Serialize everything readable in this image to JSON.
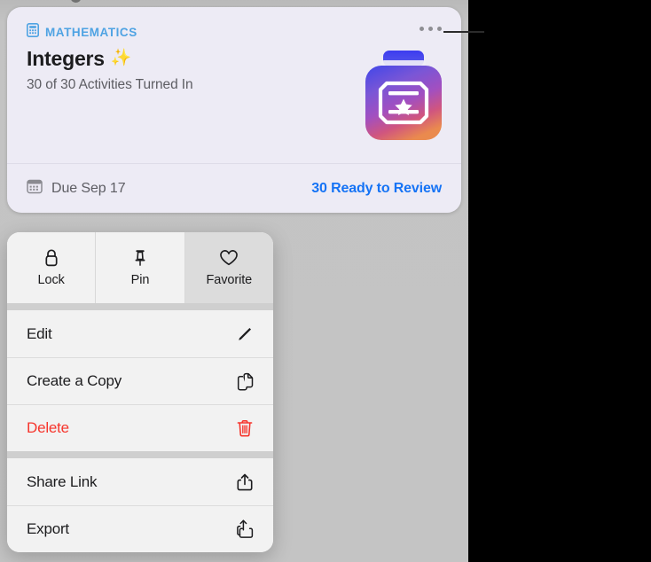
{
  "card": {
    "subject": "MATHEMATICS",
    "subject_icon": "calculator-icon",
    "title": "Integers",
    "title_emoji": "✨",
    "progress_text": "30 of 30 Activities Turned In",
    "more_button_label": "•••",
    "app_icon_name": "assignment-app-icon",
    "footer": {
      "due_icon": "calendar-icon",
      "due_text": "Due Sep 17",
      "review_link": "30 Ready to Review"
    },
    "colors": {
      "card_background": "#edebf5",
      "subject_blue": "#4fa3e3",
      "link_blue": "#1573f5",
      "secondary_text": "#5d5d63"
    }
  },
  "context_menu": {
    "quick_actions": [
      {
        "label": "Lock",
        "icon": "lock-icon"
      },
      {
        "label": "Pin",
        "icon": "pin-icon"
      },
      {
        "label": "Favorite",
        "icon": "heart-icon"
      }
    ],
    "groups": [
      {
        "items": [
          {
            "label": "Edit",
            "icon": "pencil-icon",
            "destructive": false
          },
          {
            "label": "Create a Copy",
            "icon": "duplicate-icon",
            "destructive": false
          },
          {
            "label": "Delete",
            "icon": "trash-icon",
            "destructive": true
          }
        ]
      },
      {
        "items": [
          {
            "label": "Share Link",
            "icon": "share-icon",
            "destructive": false
          },
          {
            "label": "Export",
            "icon": "export-icon",
            "destructive": false
          }
        ]
      }
    ],
    "colors": {
      "menu_background": "#f2f2f2",
      "separator": "#dcdcdc",
      "destructive_red": "#f6352c",
      "highlight": "#dcdcdc"
    }
  },
  "annotation": {
    "callout_line_name": "callout-leader-line"
  }
}
